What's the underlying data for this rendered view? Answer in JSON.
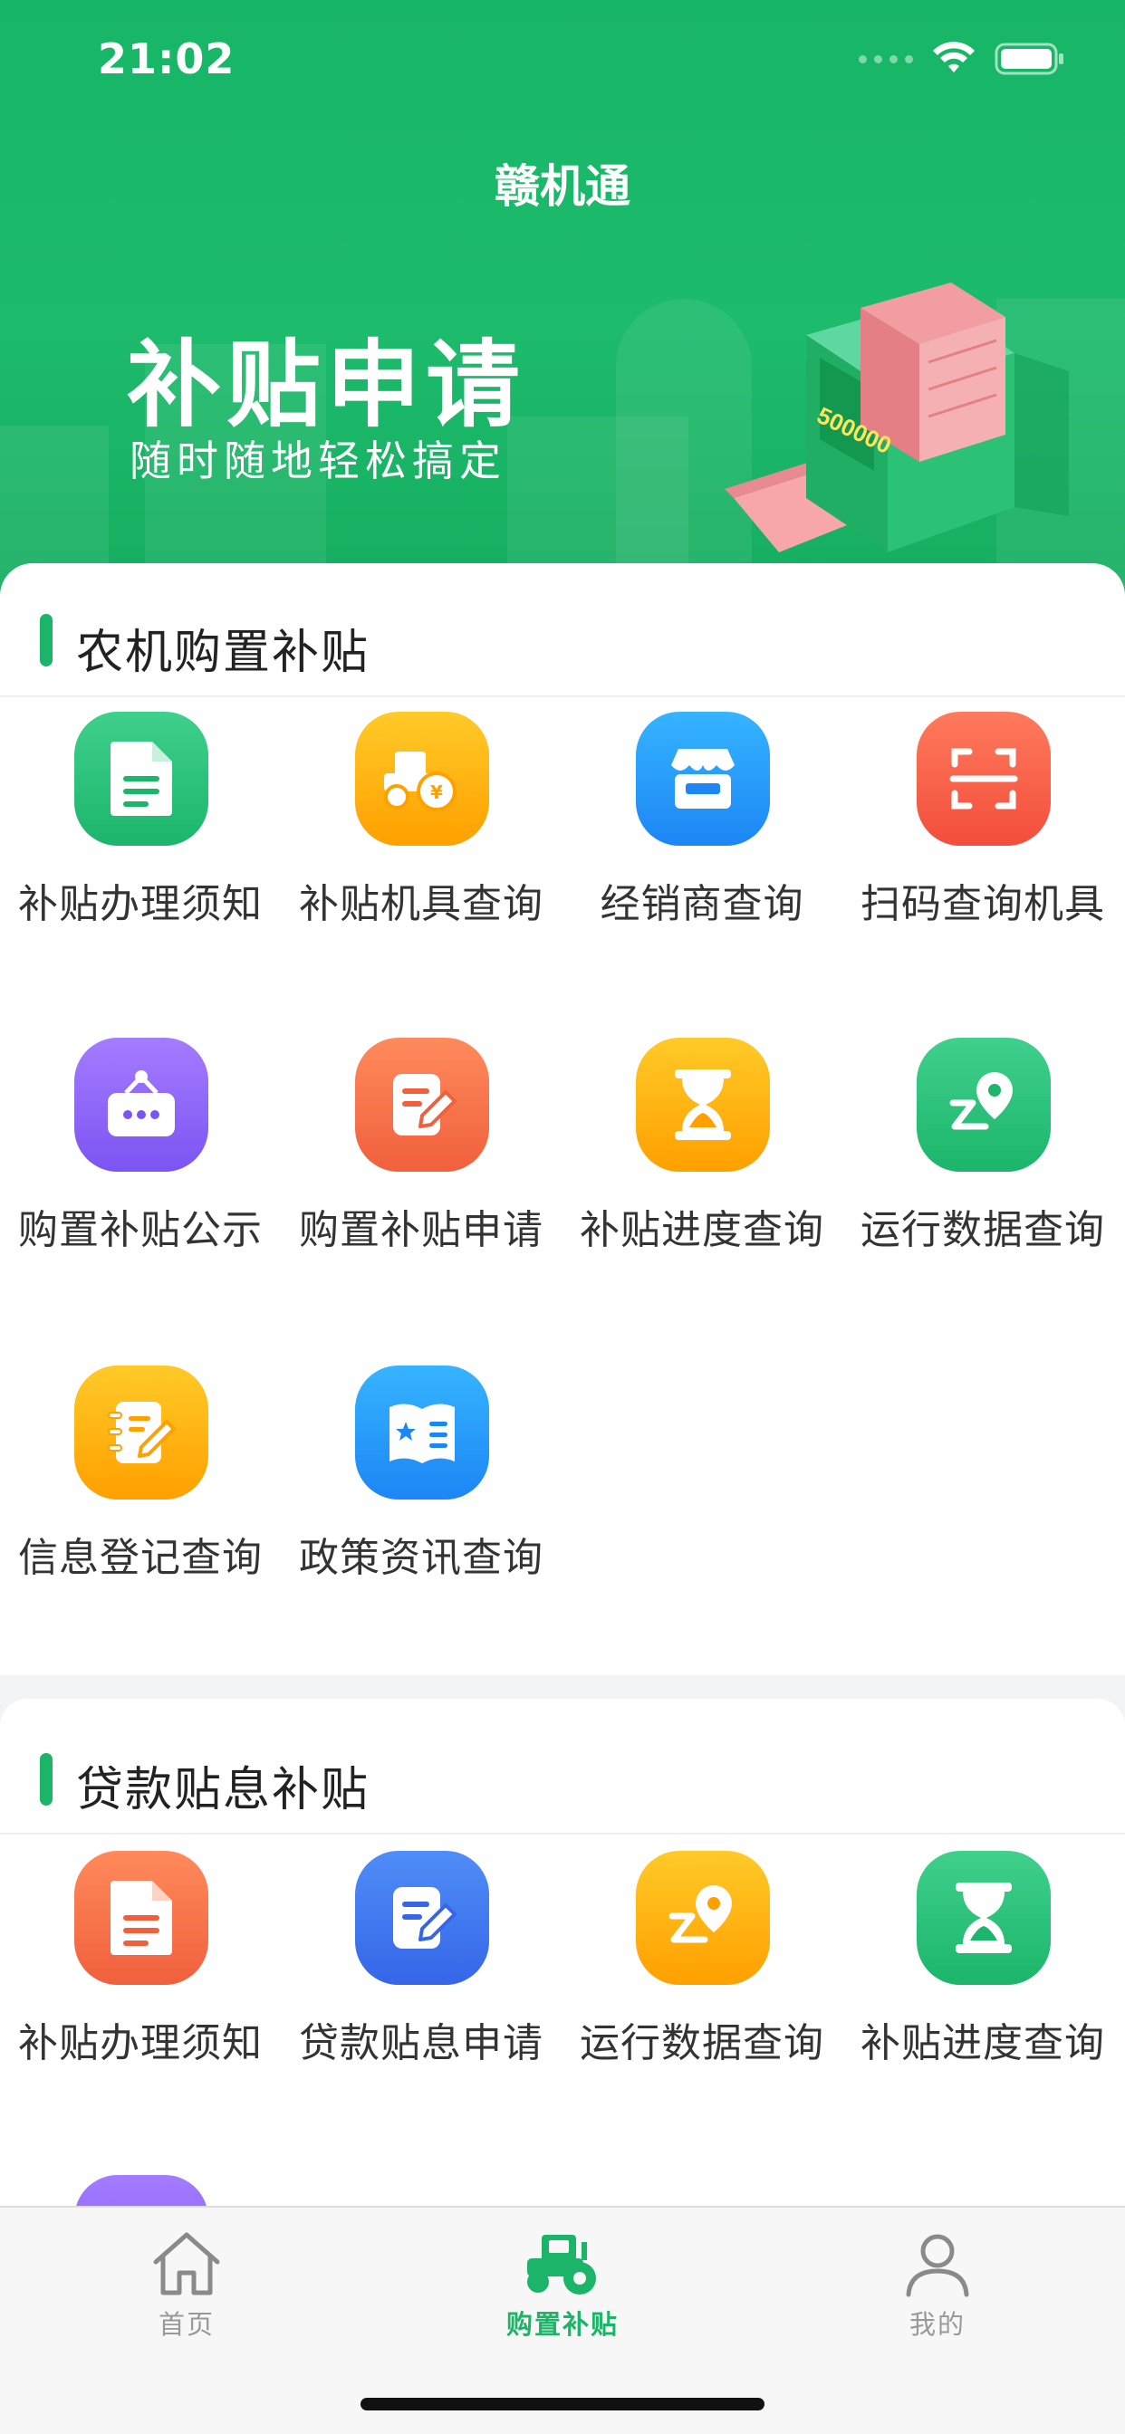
{
  "status_bar": {
    "time": "21:02"
  },
  "nav": {
    "title": "赣机通"
  },
  "banner": {
    "title": "补贴申请",
    "subtitle": "随时随地轻松搞定",
    "machine_counter": "500000"
  },
  "sections": [
    {
      "title": "农机购置补贴",
      "items": [
        {
          "label": "补贴办理须知",
          "icon": "document-icon",
          "color": "#2ec27e"
        },
        {
          "label": "补贴机具查询",
          "icon": "tractor-yen-icon",
          "color": "#ffb300"
        },
        {
          "label": "经销商查询",
          "icon": "store-icon",
          "color": "#2196f3"
        },
        {
          "label": "扫码查询机具",
          "icon": "scan-icon",
          "color": "#f4573f"
        },
        {
          "label": "购置补贴公示",
          "icon": "notice-board-icon",
          "color": "#8c63f8"
        },
        {
          "label": "购置补贴申请",
          "icon": "edit-form-icon",
          "color": "#f4573f"
        },
        {
          "label": "补贴进度查询",
          "icon": "hourglass-icon",
          "color": "#ffb300"
        },
        {
          "label": "运行数据查询",
          "icon": "location-route-icon",
          "color": "#2ec27e"
        },
        {
          "label": "信息登记查询",
          "icon": "notebook-pen-icon",
          "color": "#ffb300"
        },
        {
          "label": "政策资讯查询",
          "icon": "open-book-star-icon",
          "color": "#2196f3"
        }
      ]
    },
    {
      "title": "贷款贴息补贴",
      "items": [
        {
          "label": "补贴办理须知",
          "icon": "document-icon",
          "color": "#f26645"
        },
        {
          "label": "贷款贴息申请",
          "icon": "edit-form-icon",
          "color": "#3f74ee"
        },
        {
          "label": "运行数据查询",
          "icon": "location-route-icon",
          "color": "#ffb300"
        },
        {
          "label": "补贴进度查询",
          "icon": "hourglass-icon",
          "color": "#2ec27e"
        }
      ]
    }
  ],
  "tabbar": [
    {
      "label": "首页",
      "icon": "home-icon",
      "active": false
    },
    {
      "label": "购置补贴",
      "icon": "tractor-icon",
      "active": true
    },
    {
      "label": "我的",
      "icon": "user-icon",
      "active": false
    }
  ]
}
